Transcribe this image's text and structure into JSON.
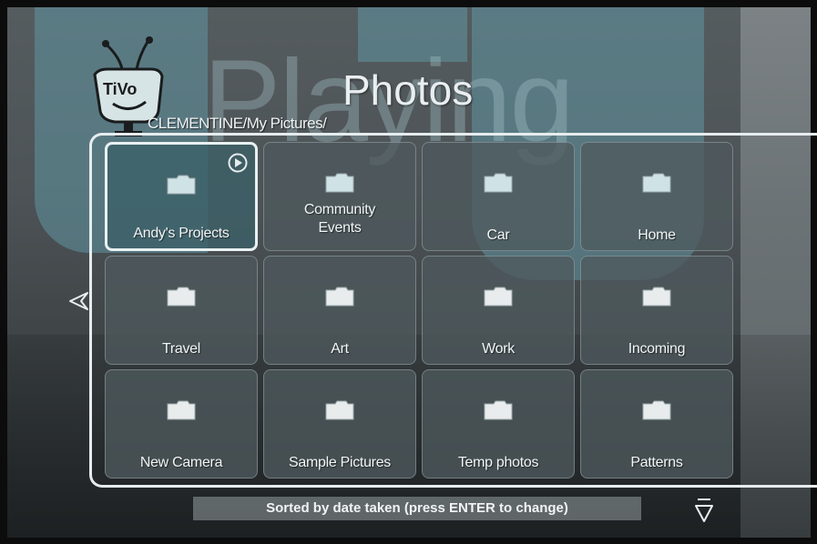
{
  "header": {
    "title": "Photos",
    "breadcrumb": "CLEMENTINE/My Pictures/",
    "background_word": "Playing"
  },
  "grid": {
    "folders": [
      {
        "label": "Andy's Projects",
        "selected": true
      },
      {
        "label": "Community Events"
      },
      {
        "label": "Car"
      },
      {
        "label": "Home"
      },
      {
        "label": "Travel"
      },
      {
        "label": "Art"
      },
      {
        "label": "Work"
      },
      {
        "label": "Incoming"
      },
      {
        "label": "New Camera"
      },
      {
        "label": "Sample Pictures"
      },
      {
        "label": "Temp photos"
      },
      {
        "label": "Patterns"
      }
    ]
  },
  "footer": {
    "sort_status": "Sorted by date taken (press ENTER to change)"
  },
  "icons": {
    "logo": "tivo-logo",
    "folder": "folder-icon",
    "play": "play-icon",
    "left": "left-arrow-icon",
    "down": "down-arrow-icon"
  },
  "colors": {
    "accent_teal": "#6096a2",
    "tile_bg": "#4e5a5e",
    "text": "#f2f5f6"
  }
}
